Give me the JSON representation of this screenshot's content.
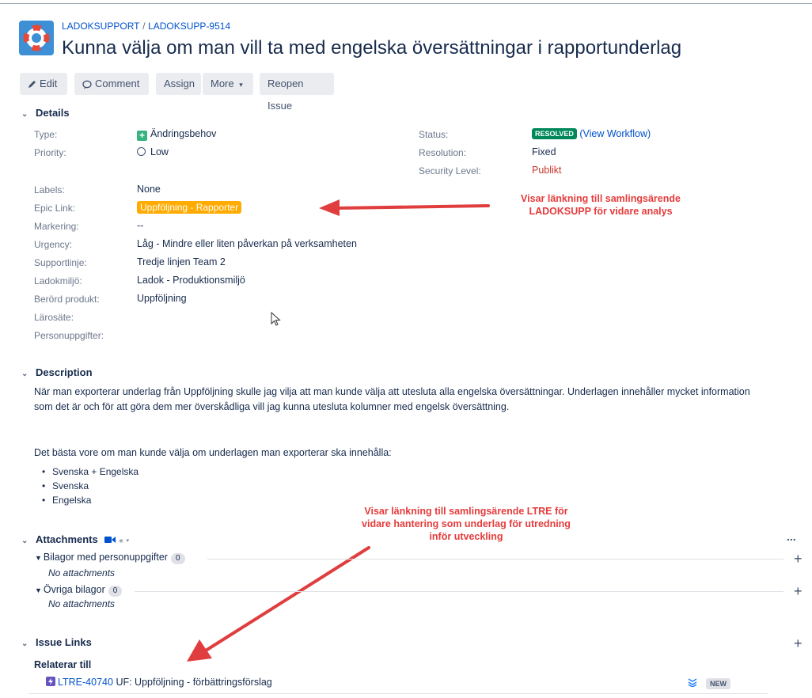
{
  "breadcrumb": {
    "project": "LADOKSUPPORT",
    "separator": "/",
    "issue_key": "LADOKSUPP-9514"
  },
  "title": "Kunna välja om man vill ta med engelska översättningar i rapportunderlag",
  "toolbar": {
    "edit": "Edit",
    "comment": "Comment",
    "assign": "Assign",
    "more": "More",
    "reopen": "Reopen Issue"
  },
  "details": {
    "heading": "Details",
    "left": [
      {
        "label": "Type:",
        "value": "Ändringsbehov"
      },
      {
        "label": "Priority:",
        "value": "Low"
      },
      {
        "label": "Labels:",
        "value": "None"
      },
      {
        "label": "Epic Link:",
        "value": "Uppföljning - Rapporter"
      },
      {
        "label": "Markering:",
        "value": "--"
      },
      {
        "label": "Urgency:",
        "value": "Låg - Mindre eller liten påverkan på verksamheten"
      },
      {
        "label": "Supportlinje:",
        "value": "Tredje linjen Team 2"
      },
      {
        "label": "Ladokmiljö:",
        "value": "Ladok - Produktionsmiljö"
      },
      {
        "label": "Berörd produkt:",
        "value": "Uppföljning"
      },
      {
        "label": "Lärosäte:",
        "value": ""
      },
      {
        "label": "Personuppgifter:",
        "value": ""
      }
    ],
    "right": [
      {
        "label": "Status:",
        "value": "RESOLVED",
        "extra": "(View Workflow)"
      },
      {
        "label": "Resolution:",
        "value": "Fixed"
      },
      {
        "label": "Security Level:",
        "value": "Publikt"
      }
    ]
  },
  "annotations": {
    "note1": [
      "Visar länkning till samlingsärende",
      "LADOKSUPP för vidare analys"
    ],
    "note2": [
      "Visar länkning till samlingsärende LTRE för",
      "vidare hantering som underlag för utredning",
      "inför utveckling"
    ]
  },
  "description": {
    "heading": "Description",
    "para1_line1": "När man exporterar underlag från Uppföljning skulle jag vilja att man kunde välja att utesluta alla engelska översättningar. Underlagen innehåller mycket information",
    "para1_line2": "som det är och för att göra dem mer överskådliga vill jag kunna utesluta kolumner med engelsk översättning.",
    "para2": "Det bästa vore om man kunde välja om underlagen man exporterar ska innehålla:",
    "bullets": [
      "Svenska + Engelska",
      "Svenska",
      "Engelska"
    ]
  },
  "attachments": {
    "heading": "Attachments",
    "more": "...",
    "groups": [
      {
        "name": "Bilagor med personuppgifter",
        "count": "0",
        "empty": "No attachments"
      },
      {
        "name": "Övriga bilagor",
        "count": "0",
        "empty": "No attachments"
      }
    ]
  },
  "issue_links": {
    "heading": "Issue Links",
    "relation": "Relaterar till",
    "link_key": "LTRE-40740",
    "link_summary": "UF: Uppföljning - förbättringsförslag",
    "status": "NEW"
  },
  "colors": {
    "accent": "#0052cc",
    "resolved": "#00875a",
    "epic": "#ffab00",
    "annotation": "#e63b3b"
  }
}
